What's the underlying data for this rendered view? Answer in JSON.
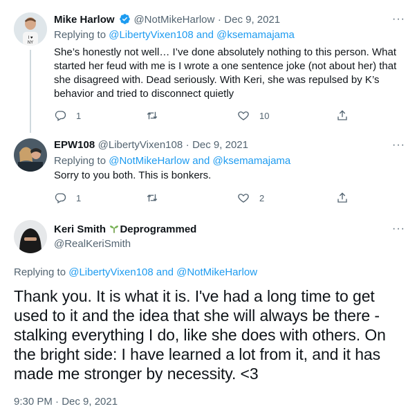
{
  "tweets": [
    {
      "name": "Mike Harlow",
      "handle": "@NotMikeHarlow",
      "sep": "·",
      "date": "Dec 9, 2021",
      "replying_prefix": "Replying to ",
      "replying_to": "@LibertyVixen108 and @ksemamajama",
      "text": "She’s honestly not well… I’ve done absolutely nothing to this person. What started her feud with me is I wrote a one sentence joke (not about her) that she disagreed with. Dead seriously. With Keri, she was repulsed by K’s behavior and tried to disconnect quietly",
      "replies": "1",
      "retweets": "",
      "likes": "10",
      "verified": true
    },
    {
      "name": "EPW108",
      "handle": "@LibertyVixen108",
      "sep": "·",
      "date": "Dec 9, 2021",
      "replying_prefix": "Replying to ",
      "replying_to": "@NotMikeHarlow and @ksemamajama",
      "text": "Sorry to you both. This is bonkers.",
      "replies": "1",
      "retweets": "",
      "likes": "2"
    }
  ],
  "main_tweet": {
    "name": "Keri Smith",
    "suffix": "Deprogrammed",
    "handle": "@RealKeriSmith",
    "replying_prefix": "Replying to ",
    "replying_to": "@LibertyVixen108 and @NotMikeHarlow",
    "text": "Thank you. It is what it is. I've had a long time to get used to it and the idea that she will always be there - stalking everything I do, like she does with others. On the bright side: I have learned a lot from it, and it has made me stronger by necessity. <3",
    "timestamp": "9:30 PM · Dec 9, 2021"
  },
  "colors": {
    "accent": "#1d9bf0",
    "muted": "#536471",
    "text": "#0f1419",
    "line": "#cfd9de"
  },
  "more_glyph": "···"
}
